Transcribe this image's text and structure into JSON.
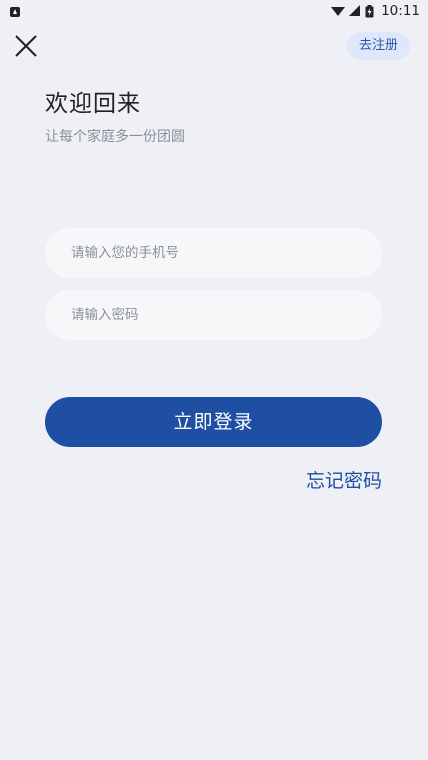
{
  "status_bar": {
    "time": "10:11",
    "icons": [
      "notification-icon",
      "wifi-icon",
      "signal-icon",
      "battery-icon"
    ]
  },
  "header": {
    "close_icon": "close-icon",
    "register_label": "去注册"
  },
  "welcome": {
    "title": "欢迎回来",
    "subtitle": "让每个家庭多一份团圆"
  },
  "form": {
    "phone_placeholder": "请输入您的手机号",
    "phone_value": "",
    "password_placeholder": "请输入密码",
    "password_value": "",
    "login_label": "立即登录",
    "forgot_label": "忘记密码"
  },
  "colors": {
    "background": "#eef0f5",
    "primary": "#1e4fa3",
    "register_bg": "#dfe8fb",
    "field_bg": "#f6f7f9"
  }
}
